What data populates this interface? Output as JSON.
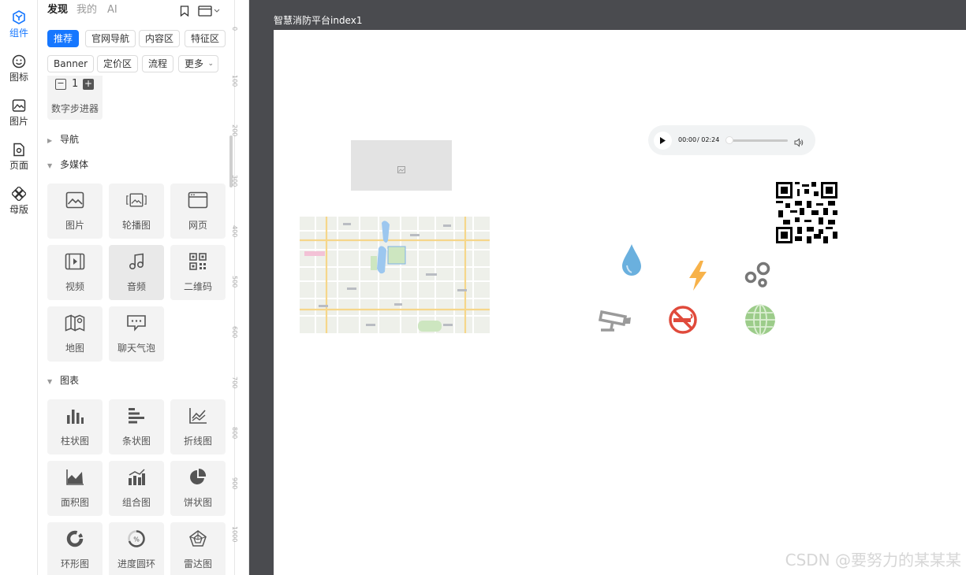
{
  "rail": {
    "items": [
      {
        "label": "组件",
        "icon": "component-icon"
      },
      {
        "label": "图标",
        "icon": "smiley-icon"
      },
      {
        "label": "图片",
        "icon": "image-icon"
      },
      {
        "label": "页面",
        "icon": "page-icon"
      },
      {
        "label": "母版",
        "icon": "master-icon"
      }
    ]
  },
  "panel": {
    "tabs": [
      "发现",
      "我的",
      "AI"
    ],
    "chips": [
      "推荐",
      "官网导航",
      "内容区",
      "特征区",
      "Banner",
      "定价区",
      "流程",
      "更多"
    ],
    "stepper": {
      "value": "1",
      "label": "数字步进器"
    },
    "sections": {
      "nav": "导航",
      "media": "多媒体",
      "charts": "图表"
    },
    "media_items": [
      "图片",
      "轮播图",
      "网页",
      "视频",
      "音频",
      "二维码",
      "地图",
      "聊天气泡"
    ],
    "chart_items": [
      "柱状图",
      "条状图",
      "折线图",
      "面积图",
      "组合图",
      "饼状图",
      "环形图",
      "进度圆环",
      "雷达图"
    ]
  },
  "ruler": {
    "ticks": [
      "0",
      "100",
      "200",
      "300",
      "400",
      "500",
      "600",
      "700",
      "800",
      "900",
      "1000"
    ]
  },
  "canvas": {
    "title": "智慧消防平台index1",
    "audio": {
      "current": "00:00",
      "total": "/ 02:24"
    },
    "watermark": "CSDN @要努力的某某某"
  },
  "colors": {
    "accent": "#1677ff",
    "canvas_bg": "#4a4b4f",
    "drop": "#6ab0de",
    "bolt": "#f7b24a",
    "nosmoke": "#e04a3b",
    "globe": "#9ccc8a"
  }
}
